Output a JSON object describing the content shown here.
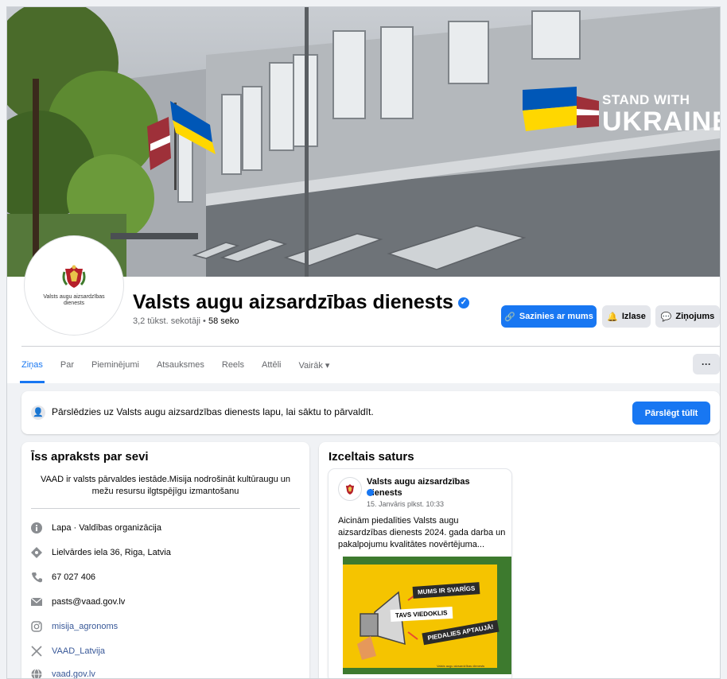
{
  "cover": {
    "banner_line1": "STAND WITH",
    "banner_line2": "UKRAINE"
  },
  "profile": {
    "avatar_text": "Valsts augu aizsardzības dienests",
    "name": "Valsts augu aizsardzības dienests",
    "followers": "3,2 tūkst. sekotāji",
    "following": "58 seko",
    "separator": " • "
  },
  "actions": {
    "contact_label": "Sazinies ar mums",
    "favorites_label": "Izlase",
    "message_label": "Ziņojums"
  },
  "tabs": [
    {
      "label": "Ziņas",
      "active": true
    },
    {
      "label": "Par"
    },
    {
      "label": "Pieminējumi"
    },
    {
      "label": "Atsauksmes"
    },
    {
      "label": "Reels"
    },
    {
      "label": "Attēli"
    },
    {
      "label": "Vairāk ▾"
    }
  ],
  "more_button": "···",
  "switch_banner": {
    "text": "Pārslēdzies uz Valsts augu aizsardzības dienests lapu, lai sāktu to pārvaldīt.",
    "button": "Pārslēgt tūlīt"
  },
  "intro": {
    "title": "Īss apraksts par sevi",
    "bio": "VAAD ir valsts pārvaldes iestāde.Misija nodrošināt kultūraugu un mežu resursu ilgtspējīgu izmantošanu",
    "items": [
      {
        "icon": "info-icon",
        "text": "Lapa · Valdības organizācija"
      },
      {
        "icon": "location-icon",
        "text": "Lielvārdes iela 36, Riga, Latvia"
      },
      {
        "icon": "phone-icon",
        "text": "67 027 406"
      },
      {
        "icon": "email-icon",
        "text": "pasts@vaad.gov.lv"
      },
      {
        "icon": "instagram-icon",
        "text": "misija_agronoms",
        "link": true
      },
      {
        "icon": "x-icon",
        "text": "VAAD_Latvija",
        "link": true
      },
      {
        "icon": "globe-icon",
        "text": "vaad.gov.lv",
        "link": true
      }
    ]
  },
  "featured": {
    "title": "Izceltais saturs",
    "post": {
      "author": "Valsts augu aizsardzības dienests",
      "date": "15. Janvāris plkst. 10:33",
      "body": "Aicinām piedalīties Valsts augu aizsardzības dienests 2024. gada darba un pakalpojumu kvalitātes novērtējuma...",
      "image_lines": [
        "MUMS IR SVARĪGS",
        "TAVS VIEDOKLIS",
        "PIEDALIES APTAUJĀ!"
      ],
      "image_caption": "Valsts augu aizsardzības dienests"
    }
  },
  "colors": {
    "accent": "#1877f2",
    "background": "#f0f2f5",
    "ukraine_blue": "#0057b7",
    "ukraine_yellow": "#ffd700",
    "latvia_red": "#9e3039"
  }
}
